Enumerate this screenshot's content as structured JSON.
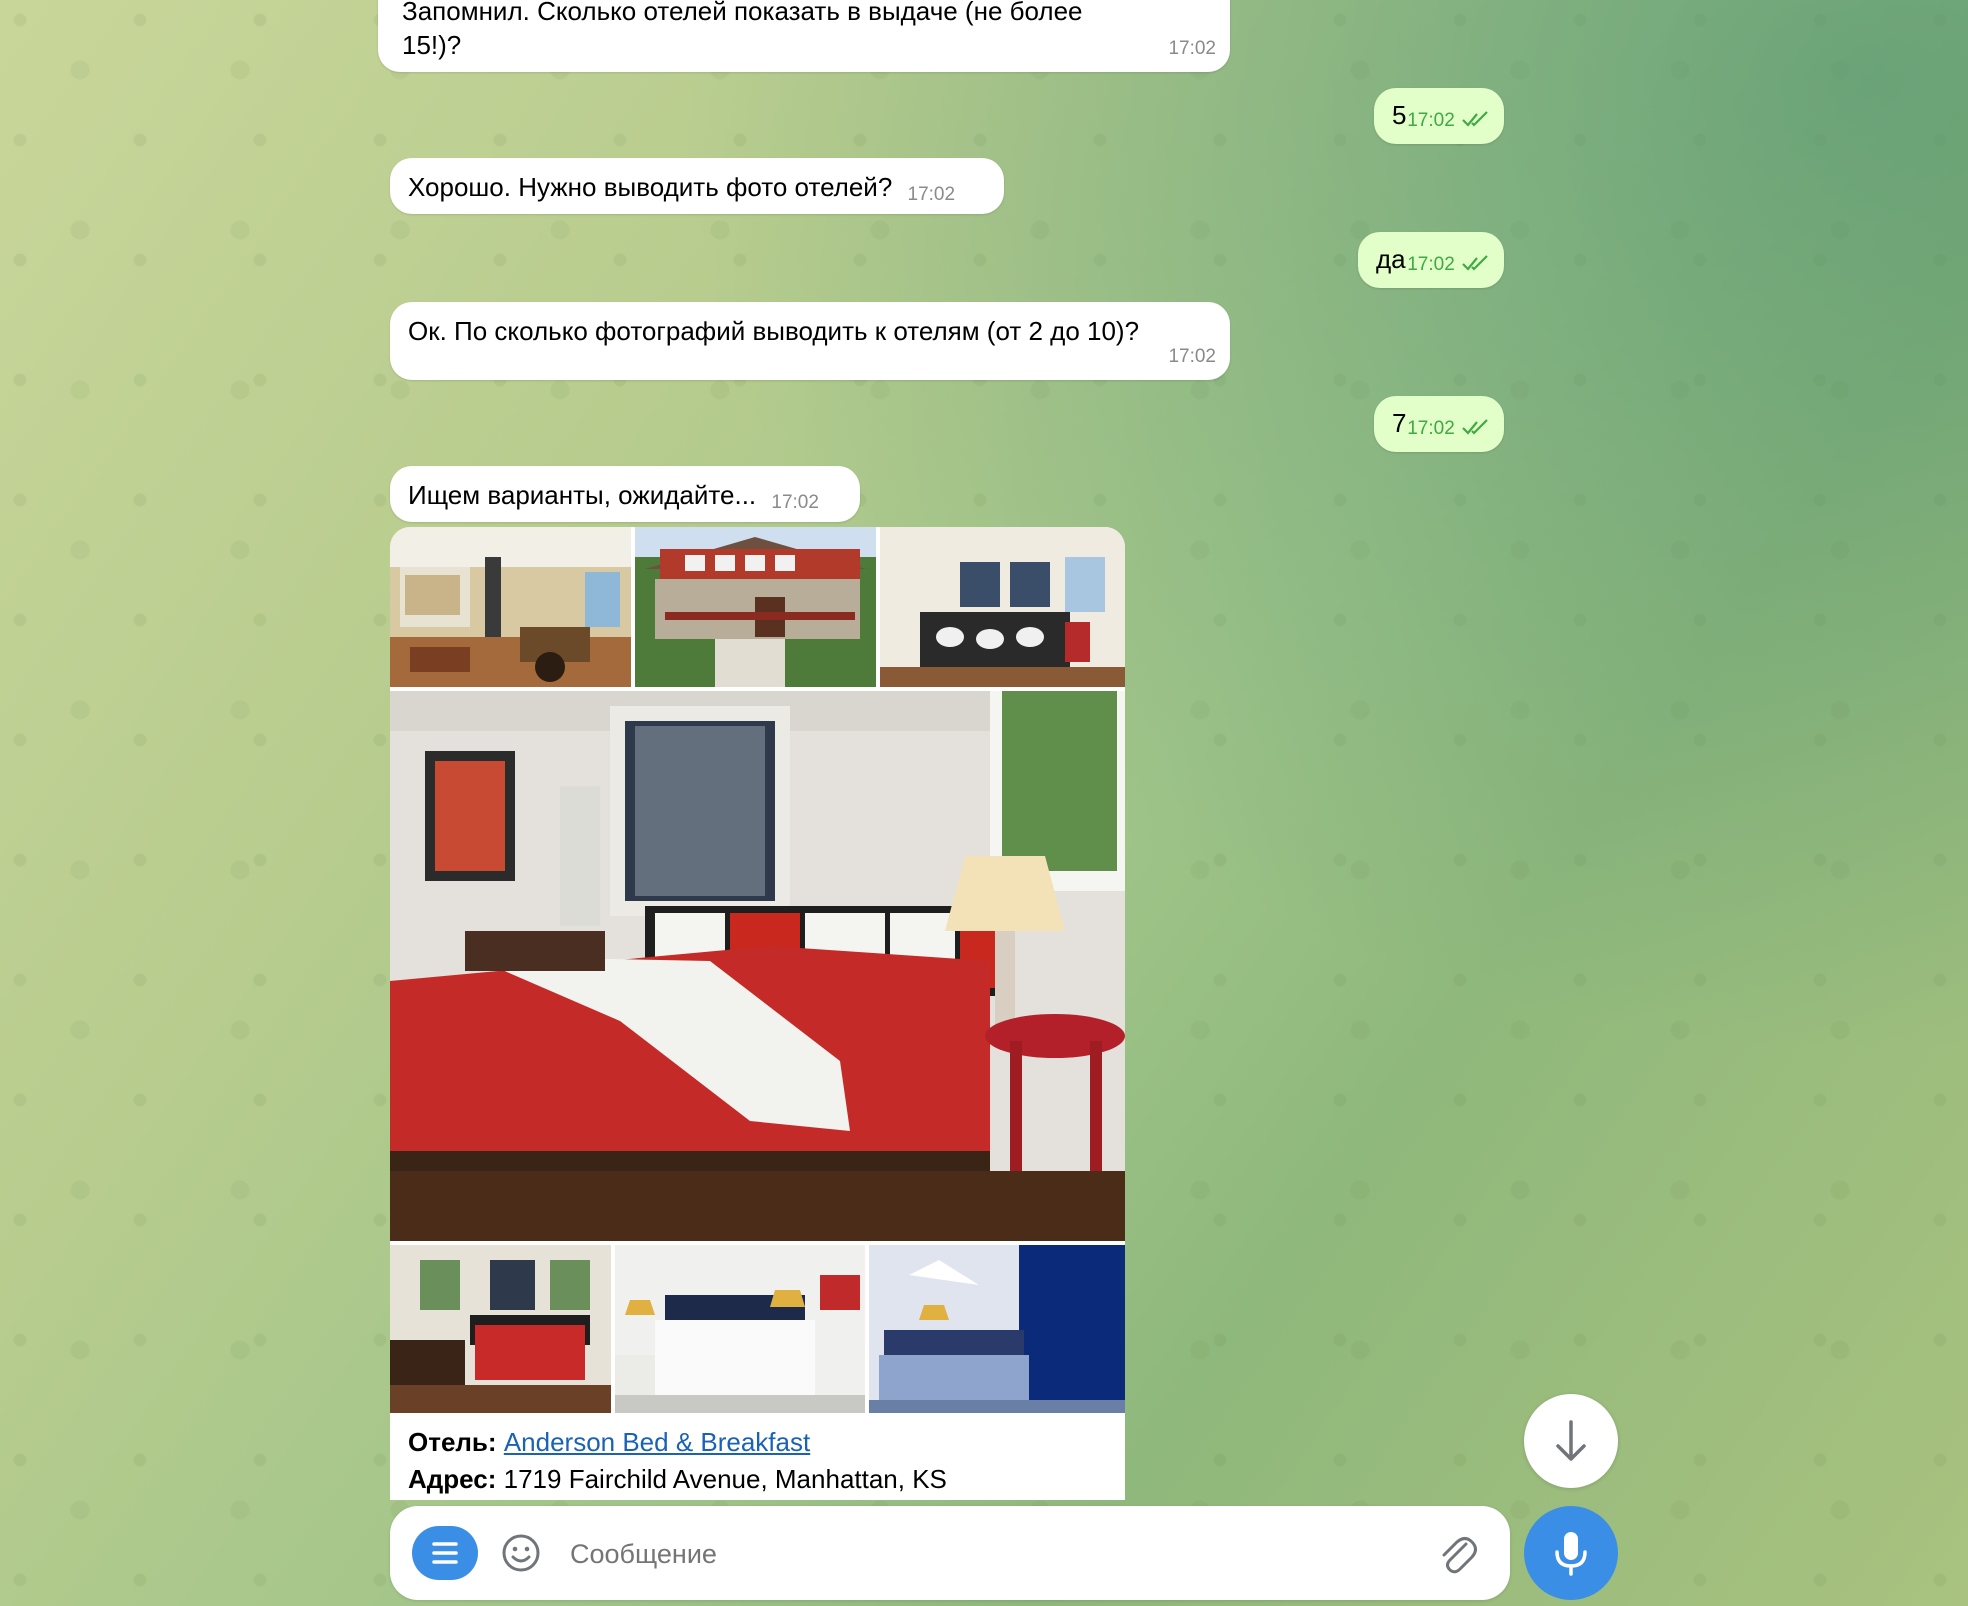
{
  "messages": [
    {
      "text": "Запомнил. Сколько отелей показать в выдаче (не более 15!)?",
      "line1": "Запомнил. Сколько отелей показать в выдаче (не более",
      "line2": "15!)?",
      "time": "17:02",
      "side": "in"
    },
    {
      "text": "5",
      "time": "17:02",
      "side": "out"
    },
    {
      "text": "Хорошо. Нужно выводить фото отелей?",
      "time": "17:02",
      "side": "in"
    },
    {
      "text": "да",
      "time": "17:02",
      "side": "out"
    },
    {
      "text": "Ок. По сколько фотографий выводить к отелям (от 2 до 10)?",
      "time": "17:02",
      "side": "in"
    },
    {
      "text": "7",
      "time": "17:02",
      "side": "out"
    },
    {
      "text": "Ищем варианты, ожидайте...",
      "time": "17:02",
      "side": "in"
    }
  ],
  "album": {
    "photo_count": 7,
    "photos": [
      {
        "name": "hotel-interior-living-room"
      },
      {
        "name": "hotel-exterior-house"
      },
      {
        "name": "hotel-bedroom-patterned-bed"
      },
      {
        "name": "hotel-bedroom-red-bed"
      },
      {
        "name": "hotel-bedroom-red-small"
      },
      {
        "name": "hotel-bedroom-white-map"
      },
      {
        "name": "hotel-bedroom-blue"
      }
    ],
    "caption": {
      "hotel_label": "Отель:",
      "hotel_name": "Anderson Bed & Breakfast",
      "address_label": "Адрес:",
      "address": "1719 Fairchild Avenue, Manhattan, KS"
    }
  },
  "composer": {
    "placeholder": "Сообщение"
  },
  "icons": {
    "menu": "menu-icon",
    "emoji": "emoji-icon",
    "attach": "paperclip-icon",
    "mic": "microphone-icon",
    "scroll_down": "arrow-down-icon"
  },
  "colors": {
    "outgoing_bubble": "#e2fec9",
    "incoming_bubble": "#ffffff",
    "accent": "#3a8ee6",
    "read_check": "#3eaa41",
    "link": "#1a62b4"
  }
}
